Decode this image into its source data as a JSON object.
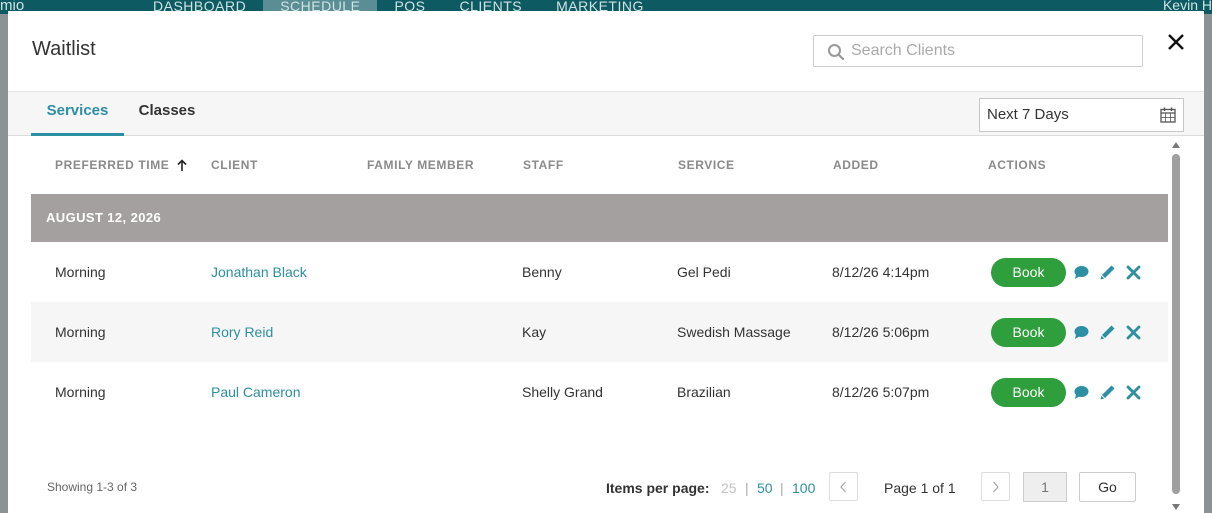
{
  "background_app": {
    "logo": "mio",
    "nav": [
      "DASHBOARD",
      "SCHEDULE",
      "POS",
      "CLIENTS",
      "MARKETING"
    ],
    "active_nav": "SCHEDULE",
    "user": "Kevin H"
  },
  "modal": {
    "title": "Waitlist",
    "search_placeholder": "Search Clients",
    "tabs": [
      {
        "label": "Services",
        "active": true
      },
      {
        "label": "Classes",
        "active": false
      }
    ],
    "date_range": "Next 7 Days"
  },
  "table": {
    "headers": [
      "PREFERRED TIME",
      "CLIENT",
      "FAMILY MEMBER",
      "STAFF",
      "SERVICE",
      "ADDED",
      "ACTIONS"
    ],
    "sort_column": "PREFERRED TIME",
    "sort_direction": "ascending",
    "group_label": "AUGUST 12, 2026",
    "book_label": "Book",
    "rows": [
      {
        "preferred_time": "Morning",
        "client": "Jonathan Black",
        "family_member": "",
        "staff": "Benny",
        "service": "Gel Pedi",
        "added": "8/12/26 4:14pm"
      },
      {
        "preferred_time": "Morning",
        "client": "Rory Reid",
        "family_member": "",
        "staff": "Kay",
        "service": "Swedish Massage",
        "added": "8/12/26 5:06pm"
      },
      {
        "preferred_time": "Morning",
        "client": "Paul Cameron",
        "family_member": "",
        "staff": "Shelly Grand",
        "service": "Brazilian",
        "added": "8/12/26 5:07pm"
      }
    ]
  },
  "footer": {
    "showing": "Showing 1-3 of 3",
    "items_per_page_label": "Items per page:",
    "items_per_page_options": [
      "25",
      "50",
      "100"
    ],
    "items_per_page_selected": "25",
    "page_label": "Page 1 of 1",
    "page_input": "1",
    "go_label": "Go"
  },
  "colors": {
    "accent": "#2d8fa3",
    "book_green": "#2f9e3c",
    "group_header": "#a4a09f",
    "topbar": "#0e5a63"
  }
}
